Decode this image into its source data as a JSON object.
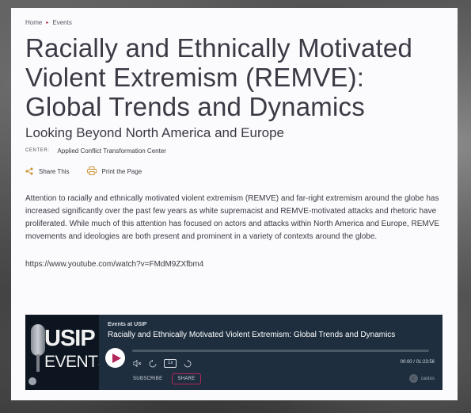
{
  "breadcrumb": {
    "home": "Home",
    "separator": "▸",
    "current": "Events"
  },
  "page": {
    "title": "Racially and Ethnically Motivated Violent Extremism (REMVE): Global Trends and Dynamics",
    "subtitle": "Looking Beyond North America and Europe",
    "center_label": "CENTER:",
    "center_value": "Applied Conflict Transformation Center"
  },
  "actions": {
    "share": "Share This",
    "print": "Print the Page"
  },
  "body": {
    "paragraph": "Attention to racially and ethnically motivated violent extremism (REMVE) and far-right extremism around the globe has increased significantly over the past few years as white supremacist and REMVE-motivated attacks and rhetoric have proliferated. While much of this attention has focused on actors and attacks within North America and Europe, REMVE movements and ideologies are both present and prominent in a variety of contexts around the globe.",
    "url": "https://www.youtube.com/watch?v=FMdM9ZXfbm4"
  },
  "player": {
    "art_title": "USIP",
    "art_subtitle": "EVENTS",
    "series": "Events at USIP",
    "episode_title": "Racially and Ethnically Motivated Violent Extremism: Global Trends and Dynamics",
    "speed": "1x",
    "time": "00:00 / 01:23:56",
    "progress": 0,
    "subscribe": "SUBSCRIBE",
    "share": "SHARE",
    "brand": "castos"
  },
  "colors": {
    "accent": "#b0102d",
    "player_bg": "#1e2e3f",
    "play_icon": "#b3265a",
    "text": "#3b3a45"
  },
  "icons": [
    "share-icon",
    "print-icon",
    "play-icon",
    "volume-icon",
    "rewind-icon",
    "forward-icon",
    "microphone-icon"
  ]
}
